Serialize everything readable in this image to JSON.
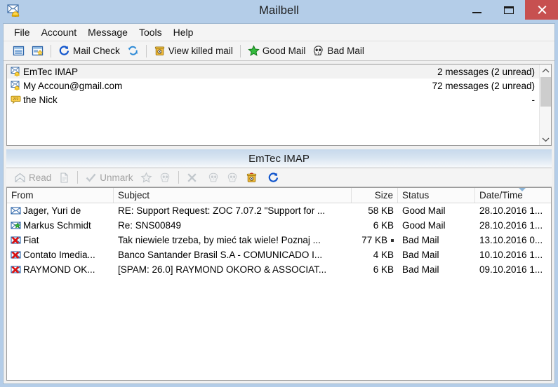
{
  "window": {
    "title": "Mailbell",
    "app_icon": "mailbell-envelope-bell-icon",
    "controls": {
      "minimize_label": "Minimize",
      "maximize_label": "Maximize",
      "close_label": "Close"
    }
  },
  "menubar": {
    "items": [
      {
        "label": "File"
      },
      {
        "label": "Account"
      },
      {
        "label": "Message"
      },
      {
        "label": "Tools"
      },
      {
        "label": "Help"
      }
    ]
  },
  "toolbar": {
    "items": [
      {
        "label": "",
        "icon": "list-view-icon",
        "name": "view-list-button"
      },
      {
        "label": "",
        "icon": "preview-window-icon",
        "name": "view-preview-button"
      },
      {
        "sep": true
      },
      {
        "label": "Mail Check",
        "icon": "refresh-blue-icon",
        "name": "mail-check-button"
      },
      {
        "label": "",
        "icon": "sync-arrows-icon",
        "name": "sync-button"
      },
      {
        "sep": true
      },
      {
        "label": "View killed mail",
        "icon": "trash-can-icon",
        "name": "view-killed-mail-button"
      },
      {
        "sep": true
      },
      {
        "label": "Good Mail",
        "icon": "green-star-icon",
        "name": "good-mail-button"
      },
      {
        "label": "Bad Mail",
        "icon": "skull-icon",
        "name": "bad-mail-button"
      }
    ]
  },
  "accounts": {
    "rows": [
      {
        "name": "EmTec IMAP",
        "count": "2 messages (2 unread)",
        "icon": "envelope-bell-icon",
        "selected": true
      },
      {
        "name": "My Accoun@gmail.com",
        "count": "72 messages (2 unread)",
        "icon": "envelope-bell-icon",
        "selected": false
      },
      {
        "name": "the Nick",
        "count": "-",
        "icon": "zzz-bubble-icon",
        "selected": false
      }
    ],
    "scrollbar": {
      "up_label": "Scroll up",
      "down_label": "Scroll down"
    }
  },
  "mail_panel": {
    "header_title": "EmTec IMAP",
    "toolbar": [
      {
        "label": "Read",
        "icon": "open-envelope-icon",
        "name": "read-button",
        "disabled": true
      },
      {
        "label": "",
        "icon": "document-icon",
        "name": "unread-button",
        "disabled": true
      },
      {
        "sep": true
      },
      {
        "label": "Unmark",
        "icon": "check-icon",
        "name": "unmark-button",
        "disabled": true
      },
      {
        "label": "",
        "icon": "star-outline-icon",
        "name": "unmark-good-button",
        "disabled": true
      },
      {
        "label": "",
        "icon": "skull-gray-icon",
        "name": "unmark-bad-button",
        "disabled": true
      },
      {
        "sep": true
      },
      {
        "label": "Mark",
        "icon": "x-mark-icon",
        "name": "mark-button",
        "disabled": true
      },
      {
        "label": "",
        "icon": "skull-gray-icon",
        "name": "mark-bad-button",
        "disabled": true
      },
      {
        "label": "",
        "icon": "skull-gray-2-icon",
        "name": "mark-bad2-button",
        "disabled": true
      },
      {
        "label": "Delete Marked",
        "icon": "trash-red-icon",
        "name": "delete-marked-button",
        "disabled": false
      },
      {
        "label": "",
        "icon": "refresh-blue-icon",
        "name": "refresh-messages-button",
        "disabled": false
      }
    ],
    "columns": [
      {
        "label": "From",
        "key": "from",
        "align": "left"
      },
      {
        "label": "Subject",
        "key": "subject",
        "align": "left"
      },
      {
        "label": "Size",
        "key": "size",
        "align": "right"
      },
      {
        "label": "Status",
        "key": "status",
        "align": "left"
      },
      {
        "label": "Date/Time",
        "key": "date",
        "align": "left",
        "sorted": "desc"
      }
    ],
    "rows": [
      {
        "icon": "envelope-unread-icon",
        "from": "Jager, Yuri de",
        "subject": "RE: Support Request: ZOC 7.07.2 \"Support for ...",
        "size": "58 KB",
        "attachment": false,
        "status": "Good Mail",
        "date": "28.10.2016 1..."
      },
      {
        "icon": "envelope-green-star-icon",
        "from": "Markus Schmidt",
        "subject": "Re: SNS00849",
        "size": "6 KB",
        "attachment": false,
        "status": "Good Mail",
        "date": "28.10.2016 1..."
      },
      {
        "icon": "envelope-red-x-icon",
        "from": "Fiat",
        "subject": "Tak niewiele trzeba, by mieć tak wiele! Poznaj ...",
        "size": "77 KB",
        "attachment": true,
        "status": "Bad Mail",
        "date": "13.10.2016 0..."
      },
      {
        "icon": "envelope-red-x-icon",
        "from": "Contato Imedia...",
        "subject": "Banco Santander Brasil S.A - COMUNICADO I...",
        "size": "4 KB",
        "attachment": false,
        "status": "Bad Mail",
        "date": "10.10.2016 1..."
      },
      {
        "icon": "envelope-red-x-icon",
        "from": "RAYMOND OK...",
        "subject": "[SPAM: 26.0] RAYMOND OKORO & ASSOCIAT...",
        "size": "6 KB",
        "attachment": false,
        "status": "Bad Mail",
        "date": "09.10.2016 1..."
      }
    ]
  },
  "colors": {
    "titlebar": "#b4cde8",
    "close_button": "#c75050",
    "toolbar_bg": "#f4f4f4",
    "selected_row": "#f2f2f2",
    "good_mail": "#1f9a2e",
    "bad_mail": "#cc2222"
  }
}
